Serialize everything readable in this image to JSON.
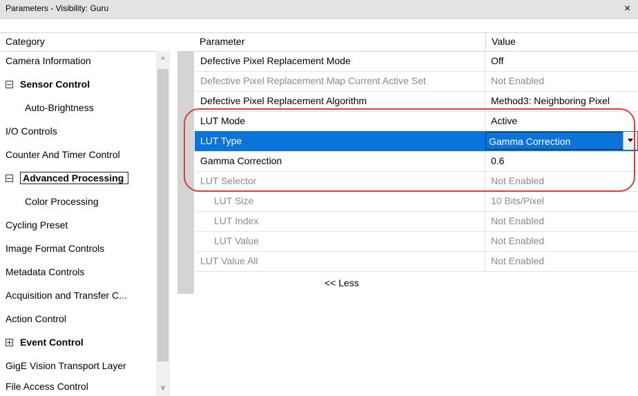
{
  "window": {
    "title": "Parameters - Visibility: Guru",
    "close_label": "×"
  },
  "left_pane": {
    "header": "Category",
    "items": [
      {
        "label": "Camera Information",
        "bold": false,
        "expander": "",
        "indent": false
      },
      {
        "label": "Sensor Control",
        "bold": true,
        "expander": "minus",
        "indent": false
      },
      {
        "label": "Auto-Brightness",
        "bold": false,
        "expander": "",
        "indent": true
      },
      {
        "label": "I/O Controls",
        "bold": false,
        "expander": "",
        "indent": false
      },
      {
        "label": "Counter And Timer Control",
        "bold": false,
        "expander": "",
        "indent": false
      },
      {
        "label": "Advanced Processing",
        "bold": true,
        "expander": "minus",
        "indent": false,
        "selected": true
      },
      {
        "label": "Color Processing",
        "bold": false,
        "expander": "",
        "indent": true
      },
      {
        "label": "Cycling Preset",
        "bold": false,
        "expander": "",
        "indent": false
      },
      {
        "label": "Image Format Controls",
        "bold": false,
        "expander": "",
        "indent": false
      },
      {
        "label": "Metadata Controls",
        "bold": false,
        "expander": "",
        "indent": false
      },
      {
        "label": "Acquisition and Transfer C...",
        "bold": false,
        "expander": "",
        "indent": false
      },
      {
        "label": "Action Control",
        "bold": false,
        "expander": "",
        "indent": false
      },
      {
        "label": "Event Control",
        "bold": true,
        "expander": "plus",
        "indent": false
      },
      {
        "label": "GigE Vision Transport Layer",
        "bold": false,
        "expander": "",
        "indent": false
      },
      {
        "label": "File Access Control",
        "bold": false,
        "expander": "",
        "indent": false
      }
    ],
    "scroll_up": "^",
    "scroll_down": "v"
  },
  "right_pane": {
    "col_parameter": "Parameter",
    "col_value": "Value",
    "rows": [
      {
        "name": "Defective Pixel Replacement Mode",
        "value": "Off",
        "disabled": false,
        "indent": false
      },
      {
        "name": "Defective Pixel Replacement Map Current Active Set",
        "value": "Not Enabled",
        "disabled": true,
        "indent": false
      },
      {
        "name": "Defective Pixel Replacement Algorithm",
        "value": "Method3: Neighboring Pixel",
        "disabled": false,
        "indent": false
      },
      {
        "name": "LUT Mode",
        "value": "Active",
        "disabled": false,
        "indent": false
      },
      {
        "name": "LUT Type",
        "value": "Gamma Correction",
        "disabled": false,
        "indent": false,
        "selected": true
      },
      {
        "name": "Gamma Correction",
        "value": "0.6",
        "disabled": false,
        "indent": false
      },
      {
        "name": "LUT Selector",
        "value": "Not Enabled",
        "disabled": true,
        "indent": false
      },
      {
        "name": "LUT Size",
        "value": "10 Bits/Pixel",
        "disabled": true,
        "indent": true
      },
      {
        "name": "LUT Index",
        "value": "Not Enabled",
        "disabled": true,
        "indent": true
      },
      {
        "name": "LUT Value",
        "value": "Not Enabled",
        "disabled": true,
        "indent": true
      },
      {
        "name": "LUT Value All",
        "value": "Not Enabled",
        "disabled": true,
        "indent": false
      }
    ],
    "less_label": "<< Less"
  },
  "colors": {
    "selection": "#0a74da",
    "highlight_ring": "#e0393c",
    "disabled_text": "#8a8a8a"
  }
}
